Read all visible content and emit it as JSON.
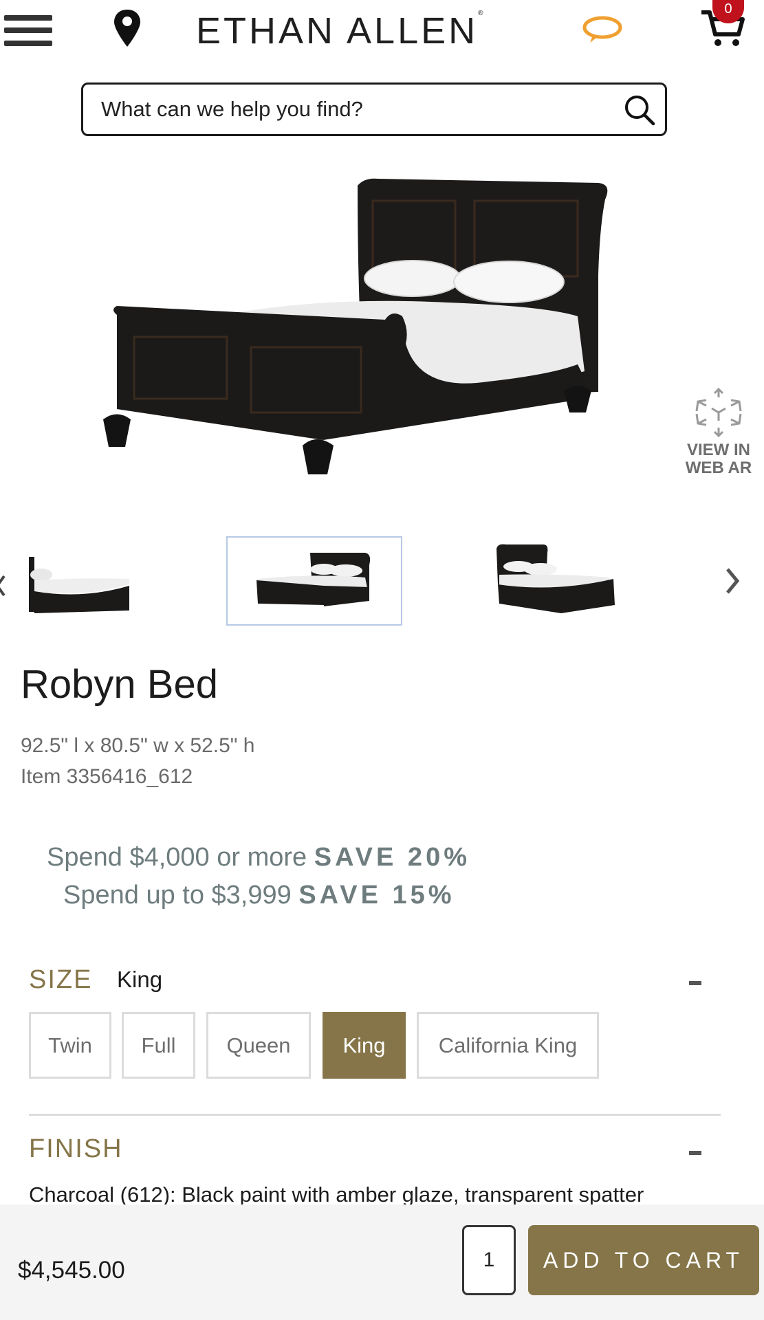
{
  "header": {
    "brand": "ETHAN ALLEN",
    "cart_count": "0",
    "icons": [
      "hamburger-menu-icon",
      "location-pin-icon",
      "chat-bubble-icon",
      "cart-icon"
    ]
  },
  "search": {
    "placeholder": "What can we help you find?"
  },
  "ar": {
    "line1": "VIEW IN",
    "line2": "WEB AR"
  },
  "product": {
    "name": "Robyn Bed",
    "dimensions": "92.5\" l x 80.5\" w x 52.5\" h",
    "item": "Item 3356416_612"
  },
  "promo": {
    "line1_text": "Spend $4,000 or more",
    "line1_save": "SAVE 20%",
    "line2_text": "Spend up to $3,999",
    "line2_save": "SAVE 15%"
  },
  "size": {
    "label": "SIZE",
    "selected": "King",
    "options": [
      "Twin",
      "Full",
      "Queen",
      "King",
      "California King"
    ]
  },
  "finish": {
    "label": "FINISH",
    "description": "Charcoal (612): Black paint with amber glaze, transparent spatter"
  },
  "cart_bar": {
    "price": "$4,545.00",
    "quantity": "1",
    "add_label": "ADD TO CART"
  },
  "colors": {
    "accent": "#857548",
    "promo": "#6e7c7e",
    "badge": "#c0121c",
    "chat": "#f0a030"
  }
}
